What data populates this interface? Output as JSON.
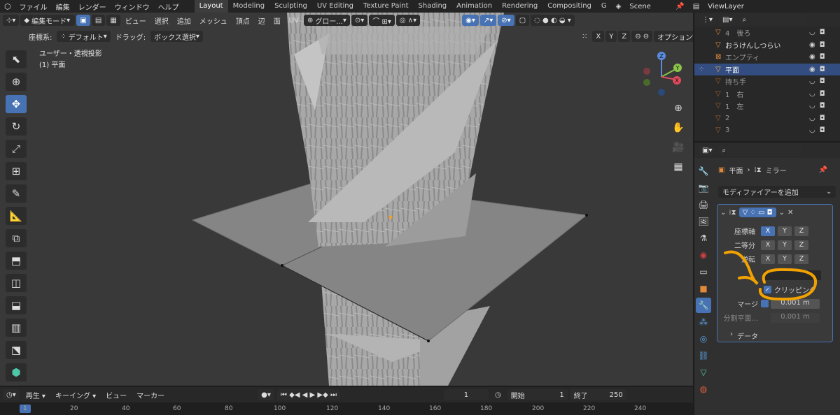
{
  "top_menu": [
    "ファイル",
    "編集",
    "レンダー",
    "ウィンドウ",
    "ヘルプ"
  ],
  "workspaces": [
    {
      "label": "Layout",
      "active": true
    },
    {
      "label": "Modeling",
      "active": false
    },
    {
      "label": "Sculpting",
      "active": false
    },
    {
      "label": "UV Editing",
      "active": false
    },
    {
      "label": "Texture Paint",
      "active": false
    },
    {
      "label": "Shading",
      "active": false
    },
    {
      "label": "Animation",
      "active": false
    },
    {
      "label": "Rendering",
      "active": false
    },
    {
      "label": "Compositing",
      "active": false
    },
    {
      "label": "G",
      "active": false
    }
  ],
  "scene": "Scene",
  "view_layer": "ViewLayer",
  "viewport_header": {
    "mode": "編集モード",
    "menus": [
      "ビュー",
      "選択",
      "追加",
      "メッシュ",
      "頂点",
      "辺",
      "面",
      "UV"
    ],
    "transform_orientation": "グロー..."
  },
  "tool_settings": {
    "coord_label": "座標系:",
    "coord_value": "デフォルト",
    "drag_label": "ドラッグ:",
    "drag_value": "ボックス選択",
    "axes": [
      "X",
      "Y",
      "Z"
    ],
    "options": "オプション"
  },
  "overlay_text": {
    "view": "ユーザー・透視投影",
    "object": "(1) 平面"
  },
  "gizmo": {
    "x": "X",
    "y": "Y",
    "z": "Z"
  },
  "outliner": [
    {
      "name": "4　後ろ",
      "selected": false,
      "dim": true
    },
    {
      "name": "おうけんしつらい",
      "selected": false,
      "dim": false
    },
    {
      "name": "エンプティ",
      "selected": false,
      "dim": true
    },
    {
      "name": "平面",
      "selected": true,
      "dim": false
    },
    {
      "name": "持ち手",
      "selected": false,
      "dim": true
    },
    {
      "name": "1　右",
      "selected": false,
      "dim": true
    },
    {
      "name": "1　左",
      "selected": false,
      "dim": true
    },
    {
      "name": "2",
      "selected": false,
      "dim": true
    },
    {
      "name": "3",
      "selected": false,
      "dim": true
    }
  ],
  "properties": {
    "breadcrumb_object": "平面",
    "breadcrumb_modifier": "ミラー",
    "add_modifier": "モディファイアーを追加",
    "axis_label": "座標軸",
    "bisect_label": "二等分",
    "flip_label": "逆転",
    "axes": [
      "X",
      "Y",
      "Z"
    ],
    "clipping_label": "クリッピング",
    "merge_label": "マージ",
    "merge_value": "0.001 m",
    "bisect_dist_label": "分割平面...",
    "bisect_dist_value": "0.001 m",
    "data_label": "データ"
  },
  "timeline": {
    "menus": [
      "再生",
      "キーイング",
      "ビュー",
      "マーカー"
    ],
    "current_frame": "1",
    "start_label": "開始",
    "start_value": "1",
    "end_label": "終了",
    "end_value": "250",
    "ticks": [
      "1",
      "20",
      "40",
      "60",
      "80",
      "100",
      "120",
      "140",
      "160",
      "180",
      "200",
      "220",
      "240"
    ]
  },
  "colors": {
    "accent": "#4772b3",
    "annotation": "#f2a200",
    "object_orange": "#e08a3a",
    "mesh_green": "#4ec9a8"
  }
}
